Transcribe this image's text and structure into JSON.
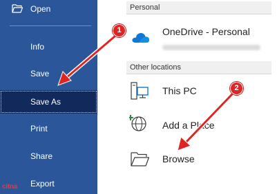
{
  "sidebar": {
    "items": [
      {
        "label": "Open",
        "icon": "folder-open-icon"
      },
      {
        "label": "Info"
      },
      {
        "label": "Save"
      },
      {
        "label": "Save As",
        "selected": true
      },
      {
        "label": "Print"
      },
      {
        "label": "Share"
      },
      {
        "label": "Export"
      }
    ]
  },
  "main": {
    "personal_header": "Personal",
    "onedrive_label": "OneDrive - Personal",
    "other_header": "Other locations",
    "locations": [
      {
        "label": "This PC",
        "icon": "computer-icon"
      },
      {
        "label": "Add a Place",
        "icon": "globe-add-icon"
      },
      {
        "label": "Browse",
        "icon": "folder-icon"
      }
    ]
  },
  "callouts": [
    "1",
    "2"
  ],
  "watermark": "citna",
  "colors": {
    "sidebar_bg": "#2b579a",
    "selected_bg": "#12295c",
    "callout_red": "#e02424",
    "onedrive_blue": "#0f78d4"
  }
}
